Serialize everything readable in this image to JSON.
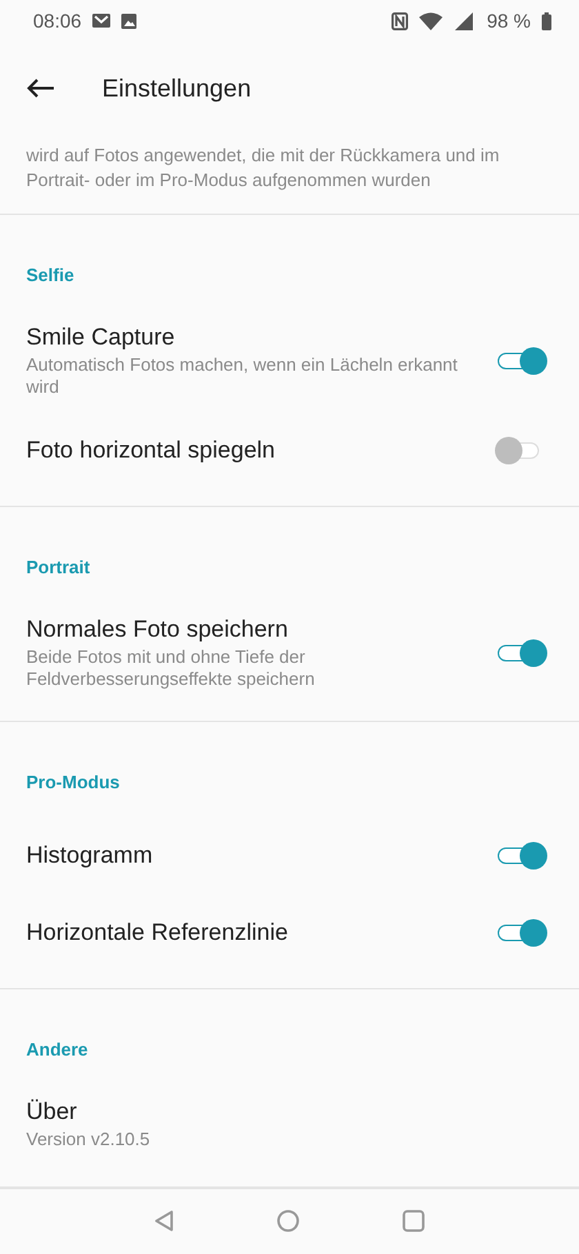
{
  "status_bar": {
    "time": "08:06",
    "battery": "98 %"
  },
  "app_bar": {
    "title": "Einstellungen"
  },
  "intro_text": [
    "wird auf Fotos angewendet, die mit der Rückkamera und im",
    "Portrait- oder im Pro-Modus aufgenommen wurden"
  ],
  "sections": [
    {
      "header": "Selfie",
      "items": [
        {
          "kind": "toggle",
          "title": "Smile Capture",
          "subtitle": "Automatisch Fotos machen, wenn ein Lächeln erkannt wird",
          "on": true
        },
        {
          "kind": "toggle",
          "title": "Foto horizontal spiegeln",
          "on": false
        }
      ]
    },
    {
      "header": "Portrait",
      "items": [
        {
          "kind": "toggle",
          "title": "Normales Foto speichern",
          "subtitle": "Beide Fotos mit und ohne Tiefe der Feldverbesserungseffekte speichern",
          "on": true
        }
      ]
    },
    {
      "header": "Pro-Modus",
      "items": [
        {
          "kind": "toggle",
          "title": "Histogramm",
          "on": true
        },
        {
          "kind": "toggle",
          "title": "Horizontale Referenzlinie",
          "on": true
        }
      ]
    },
    {
      "header": "Andere",
      "items": [
        {
          "kind": "info",
          "title": "Über",
          "subtitle": "Version v2.10.5"
        }
      ]
    }
  ]
}
